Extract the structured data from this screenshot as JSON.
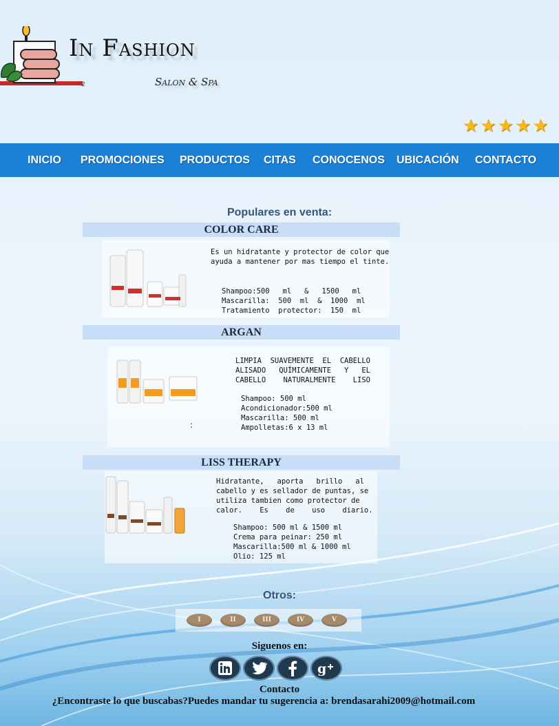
{
  "brand": {
    "title": "In Fashion",
    "subtitle": "Salon & Spa",
    "mark": "2"
  },
  "rating_stars": 5,
  "nav": {
    "items": [
      "INICIO",
      "PROMOCIONES",
      "PRODUCTOS",
      "CITAS",
      "CONOCENOS",
      "UBICACIÓN",
      "CONTACTO"
    ]
  },
  "popular_title": "Populares en venta:",
  "products": [
    {
      "name": "COLOR CARE",
      "description": "Es un hidratante y protector de color que\nayuda a mantener por mas tiempo el tinte.",
      "specs": "Shampoo:500   ml   &   1500   ml\nMascarilla:  500  ml  &  1000  ml\nTratamiento  protector:  150  ml"
    },
    {
      "name": "ARGAN",
      "description": "LIMPIA  SUAVEMENTE  EL  CABELLO\nALISADO   QUÍMICAMENTE   Y   EL\nCABELLO    NATURALMENTE    LISO",
      "specs": "Shampoo: 500 ml\nAcondicionador:500 ml\nMascarilla: 500 ml\nAmpolletas:6 x 13 ml",
      "extra_mark": ":"
    },
    {
      "name": "LISS THERAPY",
      "description": "Hidratante,   aporta   brillo   al\ncabello y es sellador de puntas, se\nutiliza tambien como protector de\ncalor.    Es    de    uso    diario.",
      "specs": "Shampoo: 500 ml & 1500 ml\nCrema para peinar: 250 ml\nMascarilla:500 ml & 1000 ml\nOlio: 125 ml"
    }
  ],
  "others_title": "Otros:",
  "pager": [
    "I",
    "II",
    "III",
    "IV",
    "V"
  ],
  "follow_label": "Siguenos en:",
  "socials": [
    "linkedin-icon",
    "twitter-icon",
    "facebook-icon",
    "google-plus-icon"
  ],
  "contact_label": "Contacto",
  "footer_note": "¿Encontraste lo que buscabas?Puedes mandar tu sugerencia a: brendasarahi2009@hotmail.com",
  "colors": {
    "nav": "#1a80d8",
    "product_bar": "#c7def6",
    "pager_button": "#a58b6c",
    "social": "#1f3a4f"
  }
}
